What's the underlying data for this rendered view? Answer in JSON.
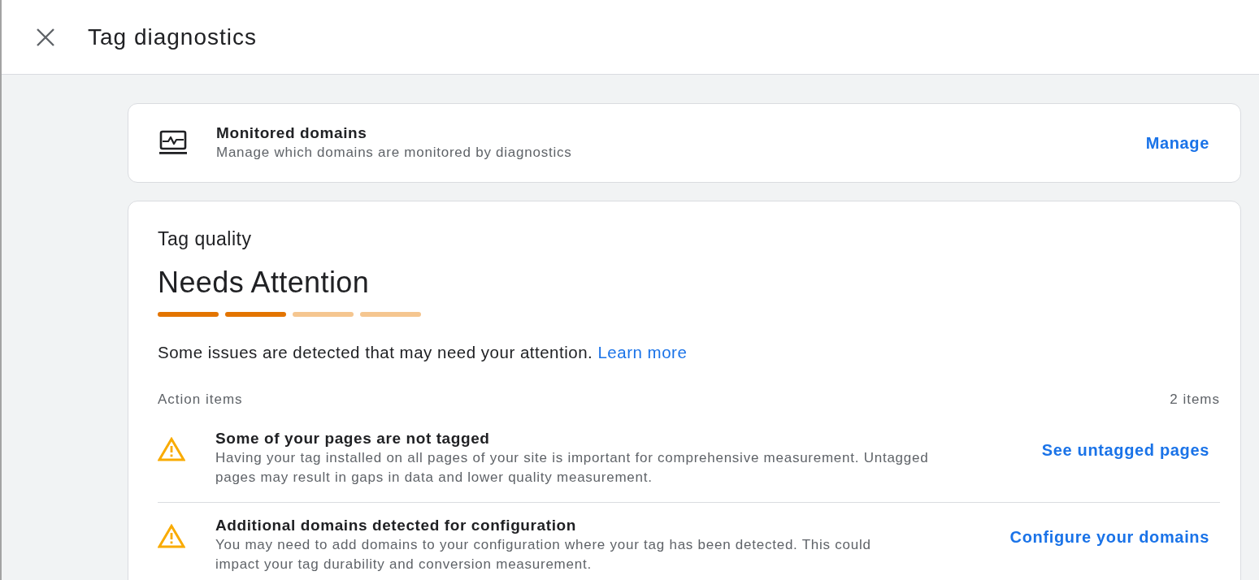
{
  "header": {
    "title": "Tag diagnostics"
  },
  "monitored_domains": {
    "title": "Monitored domains",
    "subtitle": "Manage which domains are monitored by diagnostics",
    "action": "Manage"
  },
  "tag_quality": {
    "label": "Tag quality",
    "status": "Needs Attention",
    "meter_segments": [
      {
        "filled": true
      },
      {
        "filled": true
      },
      {
        "filled": false
      },
      {
        "filled": false
      }
    ],
    "summary": "Some issues are detected that may need your attention.",
    "link": "Learn more",
    "action_items": {
      "heading": "Action items",
      "count": "2 items",
      "items": [
        {
          "title": "Some of your pages are not tagged",
          "description": "Having your tag installed on all pages of your site is important for comprehensive measurement. Untagged pages may result in gaps in data and lower quality measurement.",
          "action": "See untagged pages"
        },
        {
          "title": "Additional domains detected for configuration",
          "description": "You may need to add domains to your configuration where your tag has been detected. This could impact your tag durability and conversion measurement.",
          "action": "Configure your domains"
        }
      ]
    }
  }
}
